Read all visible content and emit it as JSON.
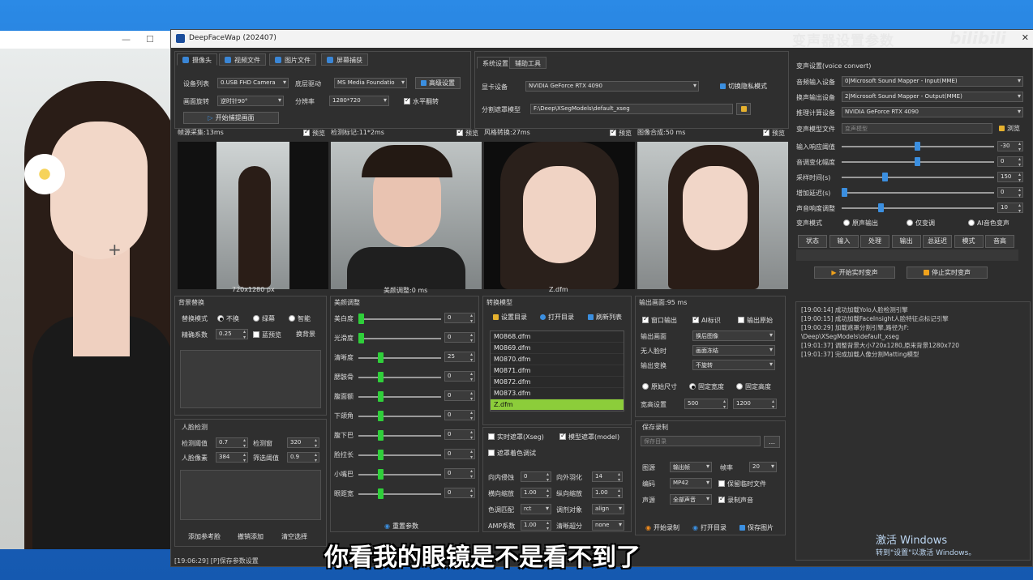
{
  "colors": {
    "accent": "#3b8fe0",
    "slider": "#2fcf3a",
    "model_selected": "#8ccd3a",
    "panel": "#2f2f2f"
  },
  "window": {
    "title": "DeepFaceWap  (202407)",
    "watermark": "变声器设置参数",
    "bili": "bilibili"
  },
  "source_tabs": [
    "摄像头",
    "视频文件",
    "图片文件",
    "屏幕捕获"
  ],
  "camera": {
    "device_list_label": "设备列表",
    "device_value": "0.USB FHD Camera",
    "driver_label": "底层驱动",
    "driver_value": "MS Media Foundatio",
    "advanced_label": "高级设置",
    "rotate_label": "画面旋转",
    "rotate_value": "逆时针90°",
    "resolution_label": "分辨率",
    "resolution_value": "1280*720",
    "flip_label": "水平翻转",
    "start_label": "开始捕提画面"
  },
  "sys_tabs": [
    "系统设置",
    "辅助工具"
  ],
  "system": {
    "gpu_label": "显卡设备",
    "gpu_value": "NVIDIA GeForce RTX 4090",
    "privacy_label": "切换隐私模式",
    "mask_label": "分割遮罩模型",
    "mask_value": "F:\\Deep\\XSegModels\\default_xseg"
  },
  "previews": [
    {
      "title": "帧源采集:13ms",
      "check": "预览",
      "caption": "720x1280 px"
    },
    {
      "title": "检测标记:11*2ms",
      "check": "预览",
      "caption": "美颜调整:0 ms"
    },
    {
      "title": "风格转换:27ms",
      "check": "预览",
      "caption": "Z.dfm"
    },
    {
      "title": "图像合成:50 ms",
      "check": "预览",
      "caption": ""
    }
  ],
  "bg_replace": {
    "title": "背景替换",
    "mode_label": "替换模式",
    "opts": [
      "不换",
      "绿幕",
      "智能"
    ],
    "precision_label": "精确系数",
    "precision_value": "0.25",
    "preview_label": "蓝预览",
    "change_label": "换背景"
  },
  "face_detect": {
    "title": "人脸检测",
    "thresh_label": "检测阈值",
    "thresh_value": "0.7",
    "window_label": "检测窗",
    "window_value": "320",
    "pixel_label": "人脸像素",
    "pixel_value": "384",
    "filter_label": "筛选阈值",
    "filter_value": "0.9",
    "add_ref": "添加参考脸",
    "undo_add": "撤销添加",
    "clear_sel": "清空选择"
  },
  "beauty": {
    "title": "美颜调整",
    "rows": [
      {
        "label": "美白度",
        "value": "0",
        "level": 0
      },
      {
        "label": "光滑度",
        "value": "0",
        "level": 0
      },
      {
        "label": "清晰度",
        "value": "25",
        "level": 0.25
      },
      {
        "label": "腮骸骨",
        "value": "0",
        "level": 0.25
      },
      {
        "label": "腹面额",
        "value": "0",
        "level": 0.25
      },
      {
        "label": "下颌角",
        "value": "0",
        "level": 0.25
      },
      {
        "label": "腹下巴",
        "value": "0",
        "level": 0.25
      },
      {
        "label": "脸拉长",
        "value": "0",
        "level": 0.25
      },
      {
        "label": "小嘴巴",
        "value": "0",
        "level": 0.25
      },
      {
        "label": "眼距宽",
        "value": "0",
        "level": 0.25
      }
    ],
    "reset": "重置参数"
  },
  "model": {
    "title": "转换模型",
    "set_dir": "设置目录",
    "open_dir": "打开目录",
    "refresh": "刷新列表",
    "items": [
      "M0868.dfm",
      "M0869.dfm",
      "M0870.dfm",
      "M0871.dfm",
      "M0872.dfm",
      "M0873.dfm",
      "Z.dfm"
    ],
    "selected": "Z.dfm",
    "realtime_mask": "实时遮罩(Xseg)",
    "model_mask": "模型遮罩(model)",
    "color_adjust": "遮罩着色调试",
    "inner_label": "向内侵蚀",
    "inner_value": "0",
    "outer_label": "向外羽化",
    "outer_value": "14",
    "hscale_label": "横向缩放",
    "hscale_value": "1.00",
    "vscale_label": "纵向缩放",
    "vscale_value": "1.00",
    "color_label": "色调匹配",
    "color_value": "rct",
    "adjust_label": "调剂对象",
    "adjust_value": "align",
    "amp_label": "AMP系数",
    "amp_value": "1.00",
    "sharp_label": "清晰超分",
    "sharp_value": "none"
  },
  "output": {
    "title": "输出画面:95 ms",
    "window_out": "窗口输出",
    "ai_mark": "AI标识",
    "out_original": "输出原始",
    "screen_label": "输出画面",
    "screen_value": "换后图像",
    "noface_label": "无人脸时",
    "noface_value": "画面冻结",
    "transform_label": "输出变换",
    "transform_value": "不旋转",
    "size_opts": [
      "原始尺寸",
      "固定宽度",
      "固定高度"
    ],
    "wh_label": "宽高设置",
    "w_value": "500",
    "h_value": "1200"
  },
  "record": {
    "title": "保存录制",
    "dir_placeholder": "保存目录",
    "source_label": "图源",
    "source_value": "输出帧",
    "fps_label": "帧率",
    "fps_value": "20",
    "codec_label": "编码",
    "codec_value": "MP42",
    "keep_temp": "保留临时文件",
    "audio_label": "声源",
    "audio_value": "全部声音",
    "rec_audio": "录制声音",
    "start": "开始录制",
    "open": "打开目录",
    "save_img": "保存图片"
  },
  "voice": {
    "title": "变声设置(voice convert)",
    "input_label": "音频输入设备",
    "input_value": "0|Microsoft Sound Mapper - Input(MME)",
    "output_label": "换声输出设备",
    "output_value": "2|Microsoft Sound Mapper - Output(MME)",
    "compute_label": "推理计算设备",
    "compute_value": "NVIDIA GeForce RTX 4090",
    "model_label": "变声模型文件",
    "model_placeholder": "变声模型",
    "browse": "浏览",
    "sliders": [
      {
        "label": "输入响应阈值",
        "value": "-30",
        "level": 0.5
      },
      {
        "label": "音调变化幅度",
        "value": "0",
        "level": 0.5
      },
      {
        "label": "采样时间(s)",
        "value": "150",
        "level": 0.28
      },
      {
        "label": "增加延迟(s)",
        "value": "0",
        "level": 0
      },
      {
        "label": "声音响度调整",
        "value": "10",
        "level": 0.25
      }
    ],
    "mode_label": "变声模式",
    "mode_opts": [
      "原声输出",
      "仅变调",
      "AI音色变声"
    ],
    "tabs": [
      "状态",
      "输入",
      "处理",
      "输出",
      "总延迟",
      "模式",
      "音高"
    ],
    "start": "开始实时变声",
    "stop": "停止实时变声"
  },
  "log": [
    "[19:00:14] 成功加载Yolo人脸检测引擎",
    "[19:00:15] 成功加载FaceInsight人脸特征点标记引擎",
    "[19:00:29] 加载遮罩分割引擎,路径为F:",
    "\\Deep\\XSegModels\\default_xseg",
    "[19:01:37] 调整背景大小720x1280,原来背景1280x720",
    "[19:01:37] 完成加载人像分割Matting模型"
  ],
  "status": "[19:06:29] [P]保存参数设置",
  "subtitle": "你看我的眼镜是不是看不到了",
  "activate": {
    "line1": "激活 Windows",
    "line2": "转到\"设置\"以激活 Windows。"
  }
}
